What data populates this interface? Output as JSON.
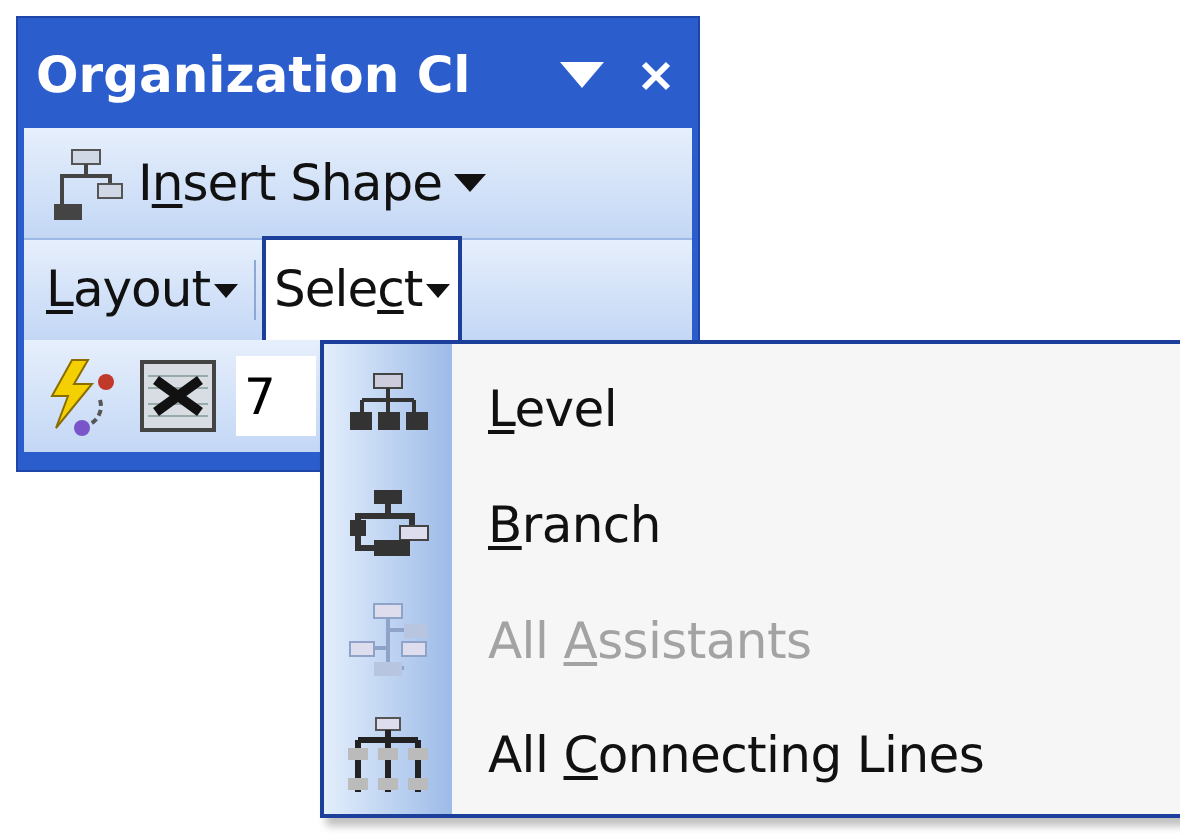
{
  "toolbar": {
    "title": "Organization Cl",
    "insert_shape": {
      "label_parts": [
        "I",
        "n",
        "sert Shape"
      ]
    },
    "menus": [
      {
        "label_parts": [
          "L",
          "ayout"
        ],
        "selected": false
      },
      {
        "label_parts": [
          "Sele",
          "c",
          "t"
        ],
        "selected": true
      }
    ],
    "zoom_field": {
      "value": "7"
    }
  },
  "select_menu": {
    "items": [
      {
        "kind": "level",
        "label_parts": [
          "L",
          "evel"
        ],
        "disabled": false
      },
      {
        "kind": "branch",
        "label_parts": [
          "B",
          "ranch"
        ],
        "disabled": false
      },
      {
        "kind": "assistants",
        "label_parts": [
          "All ",
          "A",
          "ssistants"
        ],
        "disabled": true
      },
      {
        "kind": "lines",
        "label_parts": [
          "All ",
          "C",
          "onnecting Lines"
        ],
        "disabled": false
      }
    ]
  }
}
